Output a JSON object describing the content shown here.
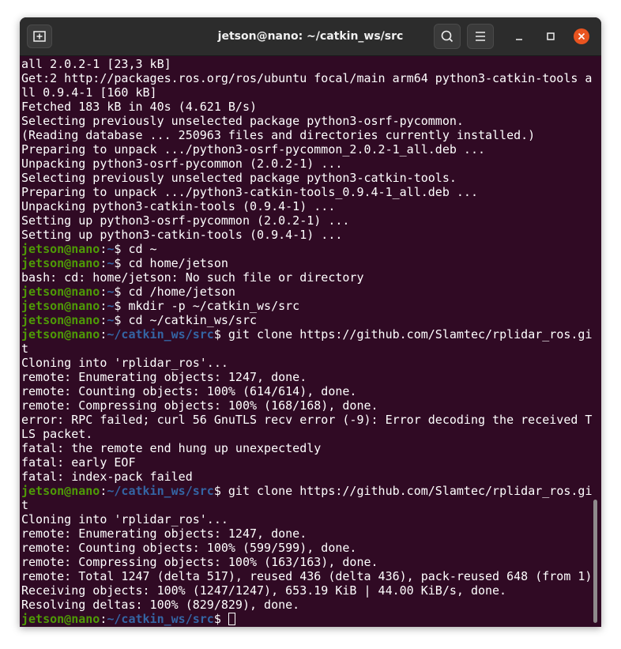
{
  "window": {
    "title": "jetson@nano: ~/catkin_ws/src"
  },
  "icons": {
    "new_tab": "new-tab-icon",
    "search": "search-icon",
    "menu": "hamburger-menu-icon",
    "minimize": "minimize-icon",
    "maximize": "maximize-icon",
    "close": "close-icon"
  },
  "colors": {
    "terminal_bg": "#300a24",
    "prompt_user": "#4e9a06",
    "prompt_path": "#3465a4",
    "text": "#ffffff",
    "close_button": "#e95420"
  },
  "terminal": {
    "lines": [
      {
        "text": "all 2.0.2-1 [23,3 kB]"
      },
      {
        "text": "Get:2 http://packages.ros.org/ros/ubuntu focal/main arm64 python3-catkin-tools a"
      },
      {
        "text": "ll 0.9.4-1 [160 kB]"
      },
      {
        "text": "Fetched 183 kB in 40s (4.621 B/s)"
      },
      {
        "text": "Selecting previously unselected package python3-osrf-pycommon."
      },
      {
        "text": "(Reading database ... 250963 files and directories currently installed.)"
      },
      {
        "text": "Preparing to unpack .../python3-osrf-pycommon_2.0.2-1_all.deb ..."
      },
      {
        "text": "Unpacking python3-osrf-pycommon (2.0.2-1) ..."
      },
      {
        "text": "Selecting previously unselected package python3-catkin-tools."
      },
      {
        "text": "Preparing to unpack .../python3-catkin-tools_0.9.4-1_all.deb ..."
      },
      {
        "text": "Unpacking python3-catkin-tools (0.9.4-1) ..."
      },
      {
        "text": "Setting up python3-osrf-pycommon (2.0.2-1) ..."
      },
      {
        "text": "Setting up python3-catkin-tools (0.9.4-1) ..."
      },
      {
        "user": "jetson@nano",
        "path": "~",
        "cmd": " cd ~"
      },
      {
        "user": "jetson@nano",
        "path": "~",
        "cmd": " cd home/jetson"
      },
      {
        "text": "bash: cd: home/jetson: No such file or directory"
      },
      {
        "user": "jetson@nano",
        "path": "~",
        "cmd": " cd /home/jetson"
      },
      {
        "user": "jetson@nano",
        "path": "~",
        "cmd": " mkdir -p ~/catkin_ws/src"
      },
      {
        "user": "jetson@nano",
        "path": "~",
        "cmd": " cd ~/catkin_ws/src"
      },
      {
        "user": "jetson@nano",
        "path": "~/catkin_ws/src",
        "cmd": " git clone https://github.com/Slamtec/rplidar_ros.gi"
      },
      {
        "text": "t"
      },
      {
        "text": "Cloning into 'rplidar_ros'..."
      },
      {
        "text": "remote: Enumerating objects: 1247, done."
      },
      {
        "text": "remote: Counting objects: 100% (614/614), done."
      },
      {
        "text": "remote: Compressing objects: 100% (168/168), done."
      },
      {
        "text": "error: RPC failed; curl 56 GnuTLS recv error (-9): Error decoding the received T"
      },
      {
        "text": "LS packet."
      },
      {
        "text": "fatal: the remote end hung up unexpectedly"
      },
      {
        "text": "fatal: early EOF"
      },
      {
        "text": "fatal: index-pack failed"
      },
      {
        "user": "jetson@nano",
        "path": "~/catkin_ws/src",
        "cmd": " git clone https://github.com/Slamtec/rplidar_ros.gi"
      },
      {
        "text": "t"
      },
      {
        "text": "Cloning into 'rplidar_ros'..."
      },
      {
        "text": "remote: Enumerating objects: 1247, done."
      },
      {
        "text": "remote: Counting objects: 100% (599/599), done."
      },
      {
        "text": "remote: Compressing objects: 100% (163/163), done."
      },
      {
        "text": "remote: Total 1247 (delta 517), reused 436 (delta 436), pack-reused 648 (from 1)"
      },
      {
        "text": "Receiving objects: 100% (1247/1247), 653.19 KiB | 44.00 KiB/s, done."
      },
      {
        "text": "Resolving deltas: 100% (829/829), done."
      },
      {
        "user": "jetson@nano",
        "path": "~/catkin_ws/src",
        "cmd": " ",
        "cursor": true
      }
    ]
  }
}
